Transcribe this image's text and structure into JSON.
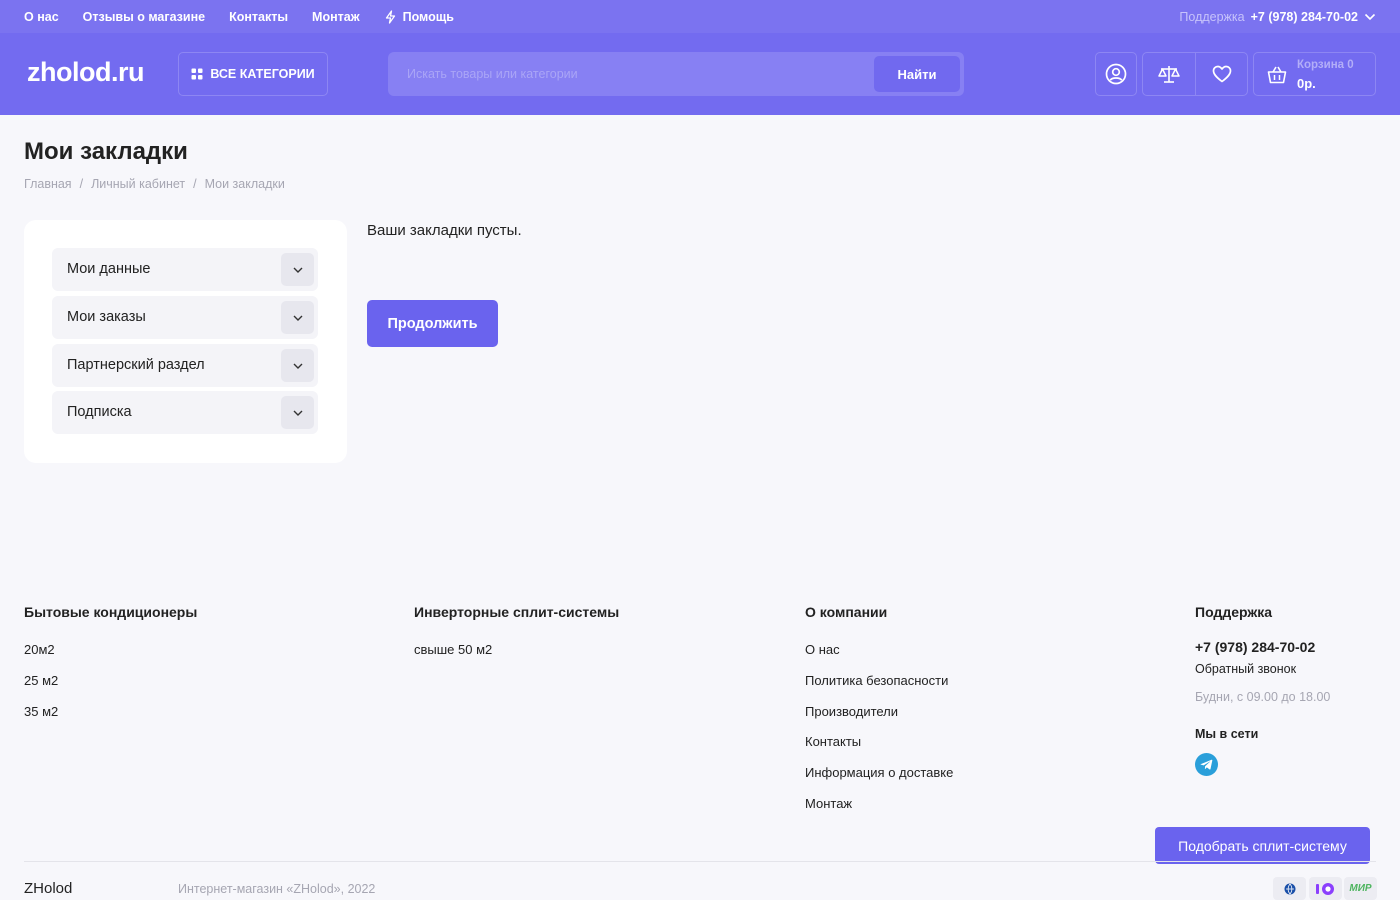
{
  "topbar": {
    "links": [
      "О нас",
      "Отзывы о магазине",
      "Контакты",
      "Монтаж",
      "Помощь"
    ],
    "support_label": "Поддержка",
    "support_phone": "+7 (978) 284-70-02"
  },
  "header": {
    "logo": "zholod.ru",
    "categories_label": "ВСЕ КАТЕГОРИИ",
    "search_placeholder": "Искать товары или категории",
    "search_button": "Найти",
    "cart_label": "Корзина 0",
    "cart_total": "0р."
  },
  "page": {
    "title": "Мои закладки",
    "breadcrumbs": [
      "Главная",
      "Личный кабинет",
      "Мои закладки"
    ],
    "sidebar": [
      "Мои данные",
      "Мои заказы",
      "Партнерский раздел",
      "Подписка"
    ],
    "empty_text": "Ваши закладки пусты.",
    "continue_button": "Продолжить"
  },
  "footer": {
    "col1": {
      "title": "Бытовые кондиционеры",
      "links": [
        "20м2",
        "25 м2",
        "35 м2"
      ]
    },
    "col2": {
      "title": "Инверторные сплит-системы",
      "links": [
        "свыше 50 м2"
      ]
    },
    "col3": {
      "title": "О компании",
      "links": [
        "О нас",
        "Политика безопасности",
        "Производители",
        "Контакты",
        "Информация о доставке",
        "Монтаж"
      ]
    },
    "support": {
      "title": "Поддержка",
      "phone": "+7 (978) 284-70-02",
      "callback": "Обратный звонок",
      "hours": "Будни, с 09.00 до 18.00",
      "social_title": "Мы в сети"
    },
    "pick_button": "Подобрать сплит-систему",
    "brand": "ZHolod",
    "copyright": "Интернет-магазин «ZHolod», 2022",
    "payment_labels": [
      "МИР"
    ]
  },
  "colors": {
    "primary": "#736bf0",
    "button": "#6a63ee",
    "background": "#f7f7fb"
  }
}
